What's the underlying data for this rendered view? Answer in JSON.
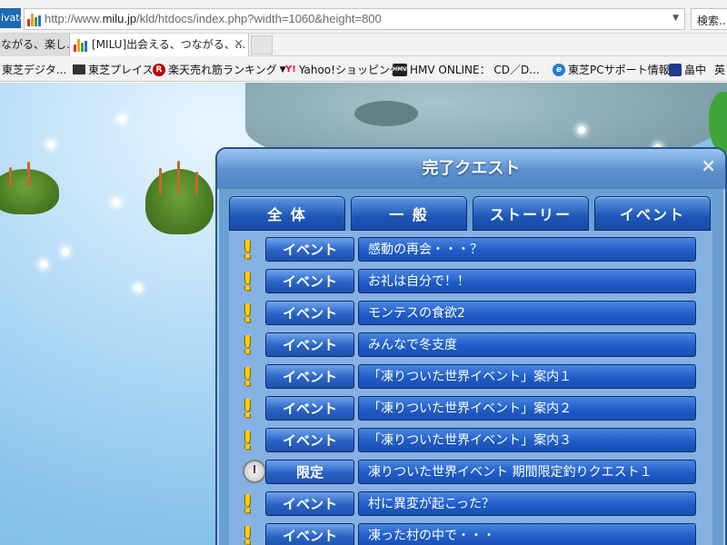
{
  "browser": {
    "inprivate_label": "ivate",
    "url_prefix": "http://www.",
    "url_domain": "milu.jp",
    "url_suffix": "/kld/htdocs/index.php?width=1060&height=800",
    "search_placeholder": "検索...",
    "tabs": [
      {
        "label": "ながる、楽し..."
      },
      {
        "label": "[MILU]出会える、つながる、...",
        "close": "×"
      }
    ],
    "favorites": [
      {
        "label": "東芝デジタ...",
        "icon": "page-icon",
        "color": "#ffffff"
      },
      {
        "label": "東芝プレイス",
        "icon": "toshiba-place-icon",
        "color": "#333333"
      },
      {
        "label": "楽天売れ筋ランキング",
        "icon": "rakuten-icon",
        "color": "#bf0000",
        "glyph": "R",
        "arrow": "▼"
      },
      {
        "label": "Yahoo!ショッピング",
        "icon": "yahoo-icon",
        "color": "#ff0033",
        "glyph": "Y!"
      },
      {
        "label": "HMV ONLINE： CD／D...",
        "icon": "hmv-icon",
        "color": "#222222",
        "glyph": "HMV"
      },
      {
        "label": "東芝PCサポート情報",
        "icon": "ie-icon",
        "color": "#1e7fd6",
        "glyph": "e"
      },
      {
        "label": "畠中",
        "icon": "bookmark-icon",
        "color": "#223a8a"
      },
      {
        "label": "英",
        "icon": "text-icon",
        "color": "#ffffff"
      }
    ]
  },
  "quest": {
    "title": "完了クエスト",
    "close": "×",
    "tabs": [
      "全 体",
      "一 般",
      "ストーリー",
      "イベント"
    ],
    "rows": [
      {
        "icon": "exclamation-icon",
        "glyph": "!",
        "category": "イベント",
        "title": "感動の再会・・・？"
      },
      {
        "icon": "exclamation-icon",
        "glyph": "!",
        "category": "イベント",
        "title": "お礼は自分で！！"
      },
      {
        "icon": "exclamation-icon",
        "glyph": "!",
        "category": "イベント",
        "title": "モンテスの食欲2"
      },
      {
        "icon": "exclamation-icon",
        "glyph": "!",
        "category": "イベント",
        "title": "みんなで冬支度"
      },
      {
        "icon": "exclamation-icon",
        "glyph": "!",
        "category": "イベント",
        "title": "「凍りついた世界イベント」案内１"
      },
      {
        "icon": "exclamation-icon",
        "glyph": "!",
        "category": "イベント",
        "title": "「凍りついた世界イベント」案内２"
      },
      {
        "icon": "exclamation-icon",
        "glyph": "!",
        "category": "イベント",
        "title": "「凍りついた世界イベント」案内３"
      },
      {
        "icon": "clock-icon",
        "glyph": "",
        "category": "限定",
        "title": "凍りついた世界イベント 期間限定釣りクエスト１"
      },
      {
        "icon": "exclamation-icon",
        "glyph": "!",
        "category": "イベント",
        "title": "村に異変が起こった？"
      },
      {
        "icon": "exclamation-icon",
        "glyph": "!",
        "category": "イベント",
        "title": "凍った村の中で・・・"
      }
    ]
  }
}
